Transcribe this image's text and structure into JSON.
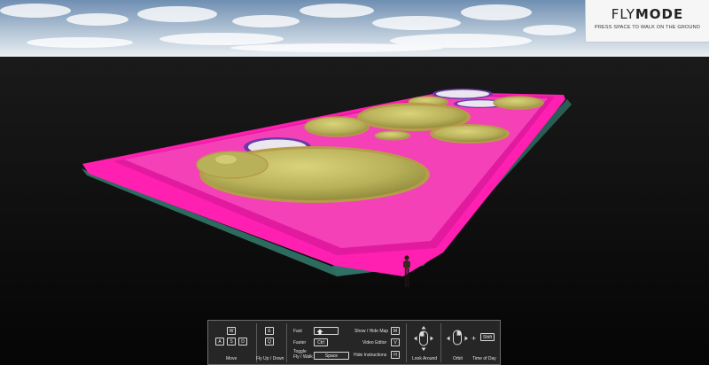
{
  "mode_panel": {
    "title_light": "FLY",
    "title_bold": "MODE",
    "hint": "PRESS SPACE TO WALK ON THE GROUND"
  },
  "controls": {
    "move": {
      "keys": [
        "W",
        "A",
        "S",
        "D"
      ],
      "label": "Move"
    },
    "fly": {
      "keys": [
        "E",
        "Q"
      ],
      "label": "Fly Up / Down"
    },
    "fast": {
      "label": "Fast",
      "key_icon": "shift-arrow-icon"
    },
    "faster": {
      "label": "Faster",
      "key": "Ctrl"
    },
    "toggle": {
      "label": "Toggle\nFly / Walk",
      "key": "Space"
    },
    "show_hide_map": {
      "label": "Show / Hide Map",
      "key": "M"
    },
    "video_editor": {
      "label": "Video Editor",
      "key": "V"
    },
    "hide_instructions": {
      "label": "Hide Instructions",
      "key": "H"
    },
    "look_around": {
      "label": "Look Around",
      "icon": "mouse-look-icon"
    },
    "orbit": {
      "label": "Orbit",
      "icon": "mouse-orbit-icon"
    },
    "plus": "+",
    "time_of_day": {
      "label": "Time of Day",
      "key": "Shift"
    }
  },
  "colors": {
    "sky_top": "#7f9cba",
    "sky_horizon": "#dfe6ee",
    "ground": "#0c0c0c",
    "platform_pink": "#ff1fb0",
    "platform_edge": "#d11596",
    "inner_pink": "#f23fb8",
    "teal_wall": "#2d6b5f",
    "hill": "#c7c26a",
    "hill_dark": "#8f8a3f",
    "rim": "#b79a4a",
    "pond_rim": "#6a3aa8",
    "pond": "#e8e4ee",
    "panel_bg": "#262626"
  }
}
